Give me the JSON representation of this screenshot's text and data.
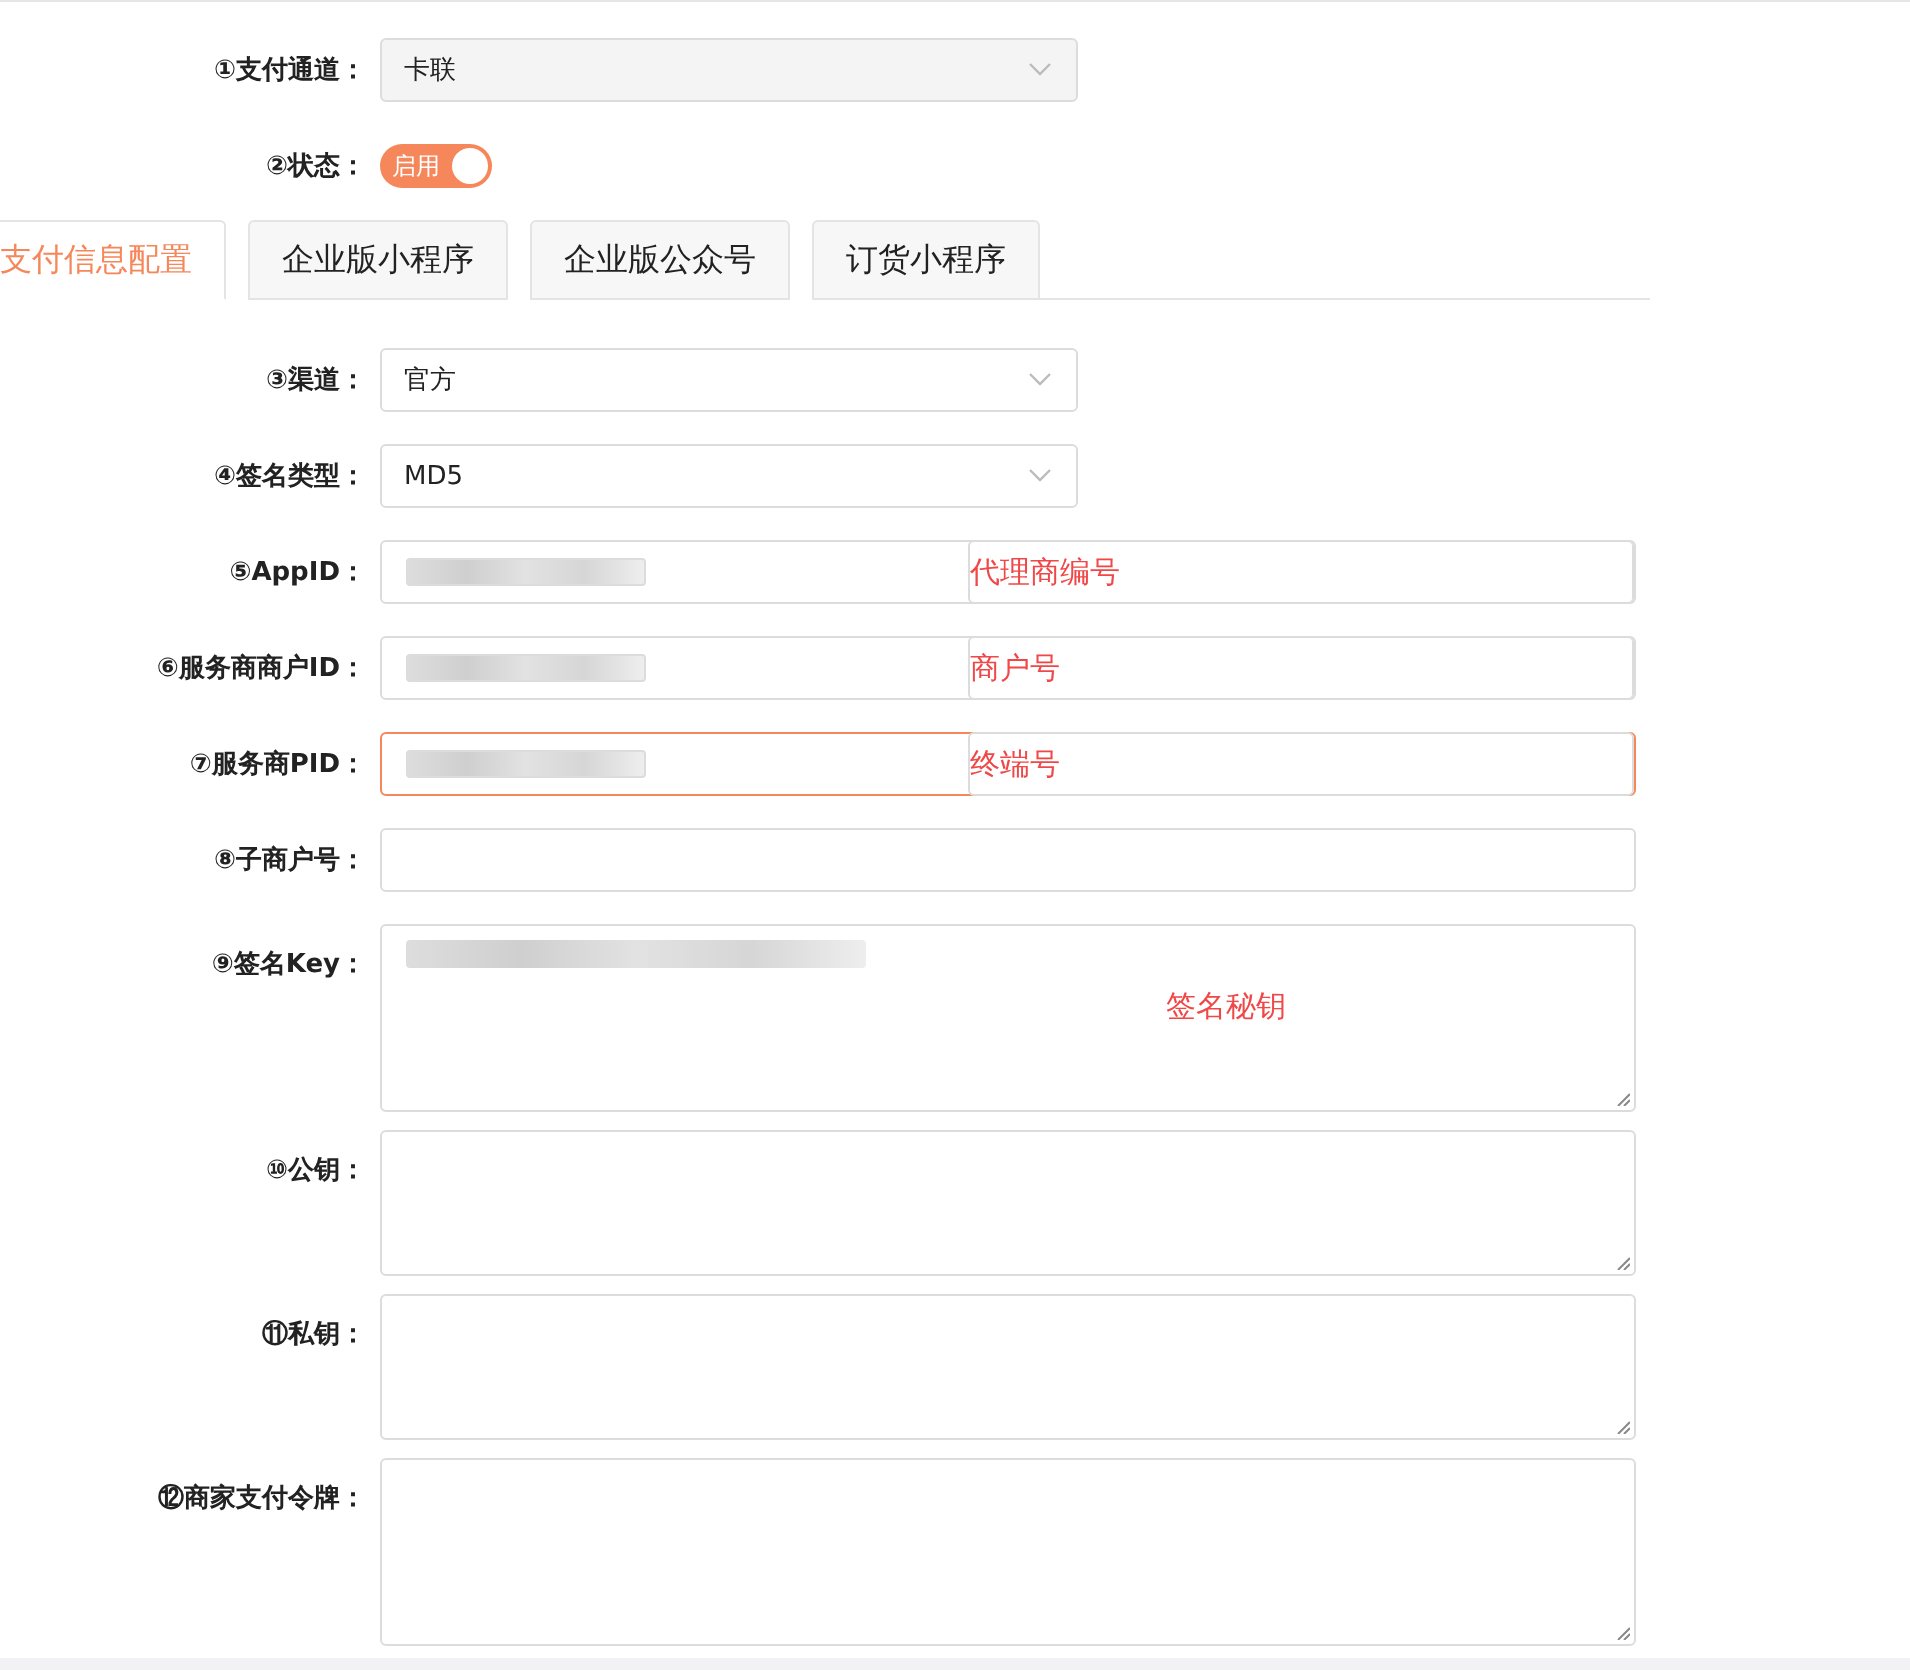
{
  "top_fields": [
    {
      "label": "①支付通道：",
      "kind": "select",
      "value": "卡联"
    },
    {
      "label": "②状态：",
      "kind": "toggle",
      "on": true,
      "text": "启用"
    }
  ],
  "tabs": [
    {
      "label": "支付信息配置",
      "selected": true
    },
    {
      "label": "企业版小程序",
      "selected": false
    },
    {
      "label": "企业版公众号",
      "selected": false
    },
    {
      "label": "订货小程序",
      "selected": false
    }
  ],
  "fields": [
    {
      "label": "③渠道：",
      "kind": "select",
      "value": "官方"
    },
    {
      "label": "④签名类型：",
      "kind": "select",
      "value": "MD5"
    },
    {
      "label": "⑤AppID：",
      "kind": "input",
      "redacted": true,
      "annotation": "代理商编号",
      "focused": false
    },
    {
      "label": "⑥服务商商户ID：",
      "kind": "input",
      "redacted": true,
      "annotation": "商户号",
      "focused": false
    },
    {
      "label": "⑦服务商PID：",
      "kind": "input",
      "redacted": true,
      "annotation": "终端号",
      "focused": true
    },
    {
      "label": "⑧子商户号：",
      "kind": "input",
      "focused": false
    },
    {
      "label": "⑨签名Key：",
      "kind": "textarea",
      "redacted": true,
      "annotation": "签名秘钥"
    },
    {
      "label": "⑩公钥：",
      "kind": "textarea"
    },
    {
      "label": "⑪私钥：",
      "kind": "textarea"
    },
    {
      "label": "⑫商家支付令牌：",
      "kind": "textarea"
    }
  ]
}
